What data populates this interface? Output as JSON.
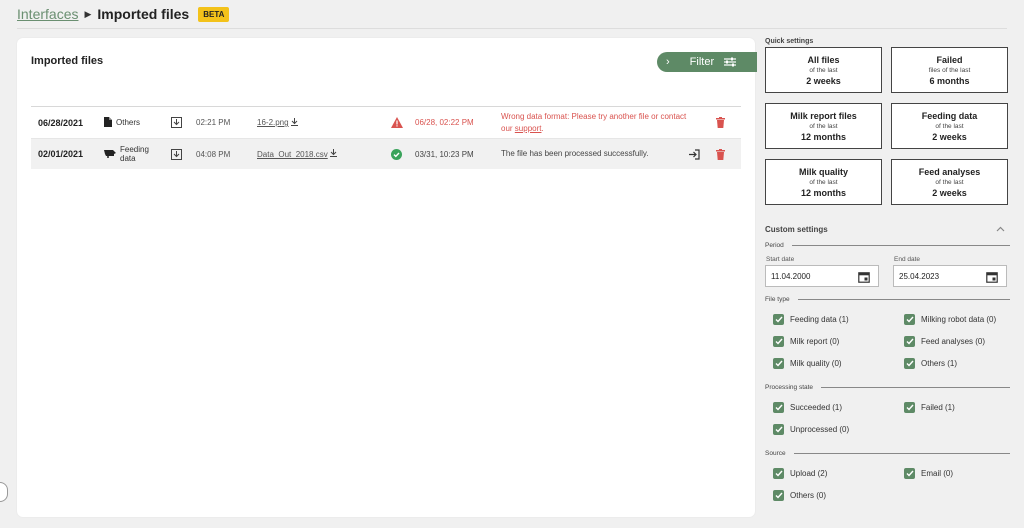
{
  "breadcrumb": {
    "parent": "Interfaces",
    "current": "Imported files",
    "badge": "BETA"
  },
  "main": {
    "title": "Imported files",
    "filter_label": "Filter",
    "rows": [
      {
        "date": "06/28/2021",
        "type": "Others",
        "time": "02:21 PM",
        "filename": "16-2.png",
        "status": "error",
        "processed": "06/28, 02:22 PM",
        "message": "Wrong data format: Please try another file or contact our",
        "message_link": "support",
        "message_end": "."
      },
      {
        "date": "02/01/2021",
        "type_line1": "Feeding",
        "type_line2": "data",
        "time": "04:08 PM",
        "filename": "Data_Out_2018.csv",
        "status": "success",
        "processed": "03/31, 10:23 PM",
        "message": "The file has been processed successfully."
      }
    ]
  },
  "quick_settings": {
    "heading": "Quick settings",
    "cards": [
      {
        "title": "All files",
        "sub": "of the last",
        "value": "2 weeks"
      },
      {
        "title": "Failed",
        "sub": "files of the last",
        "value": "6 months"
      },
      {
        "title": "Milk report files",
        "sub": "of the last",
        "value": "12 months"
      },
      {
        "title": "Feeding data",
        "sub": "of the last",
        "value": "2 weeks"
      },
      {
        "title": "Milk quality",
        "sub": "of the last",
        "value": "12 months"
      },
      {
        "title": "Feed analyses",
        "sub": "of the last",
        "value": "2 weeks"
      }
    ]
  },
  "custom_settings": {
    "heading": "Custom settings",
    "period_label": "Period",
    "start_label": "Start date",
    "start_value": "11.04.2000",
    "end_label": "End date",
    "end_value": "25.04.2023",
    "file_type_label": "File type",
    "file_types": [
      "Feeding data (1)",
      "Milking robot data (0)",
      "Milk report (0)",
      "Feed analyses (0)",
      "Milk quality (0)",
      "Others (1)"
    ],
    "processing_label": "Processing state",
    "processing": [
      "Succeeded (1)",
      "Failed (1)",
      "Unprocessed (0)"
    ],
    "source_label": "Source",
    "sources": [
      "Upload (2)",
      "Email (0)",
      "Others (0)"
    ]
  },
  "colors": {
    "accent": "#5e8a66",
    "error": "#d9534f",
    "success": "#3aa35b",
    "badge": "#f3c21a"
  }
}
